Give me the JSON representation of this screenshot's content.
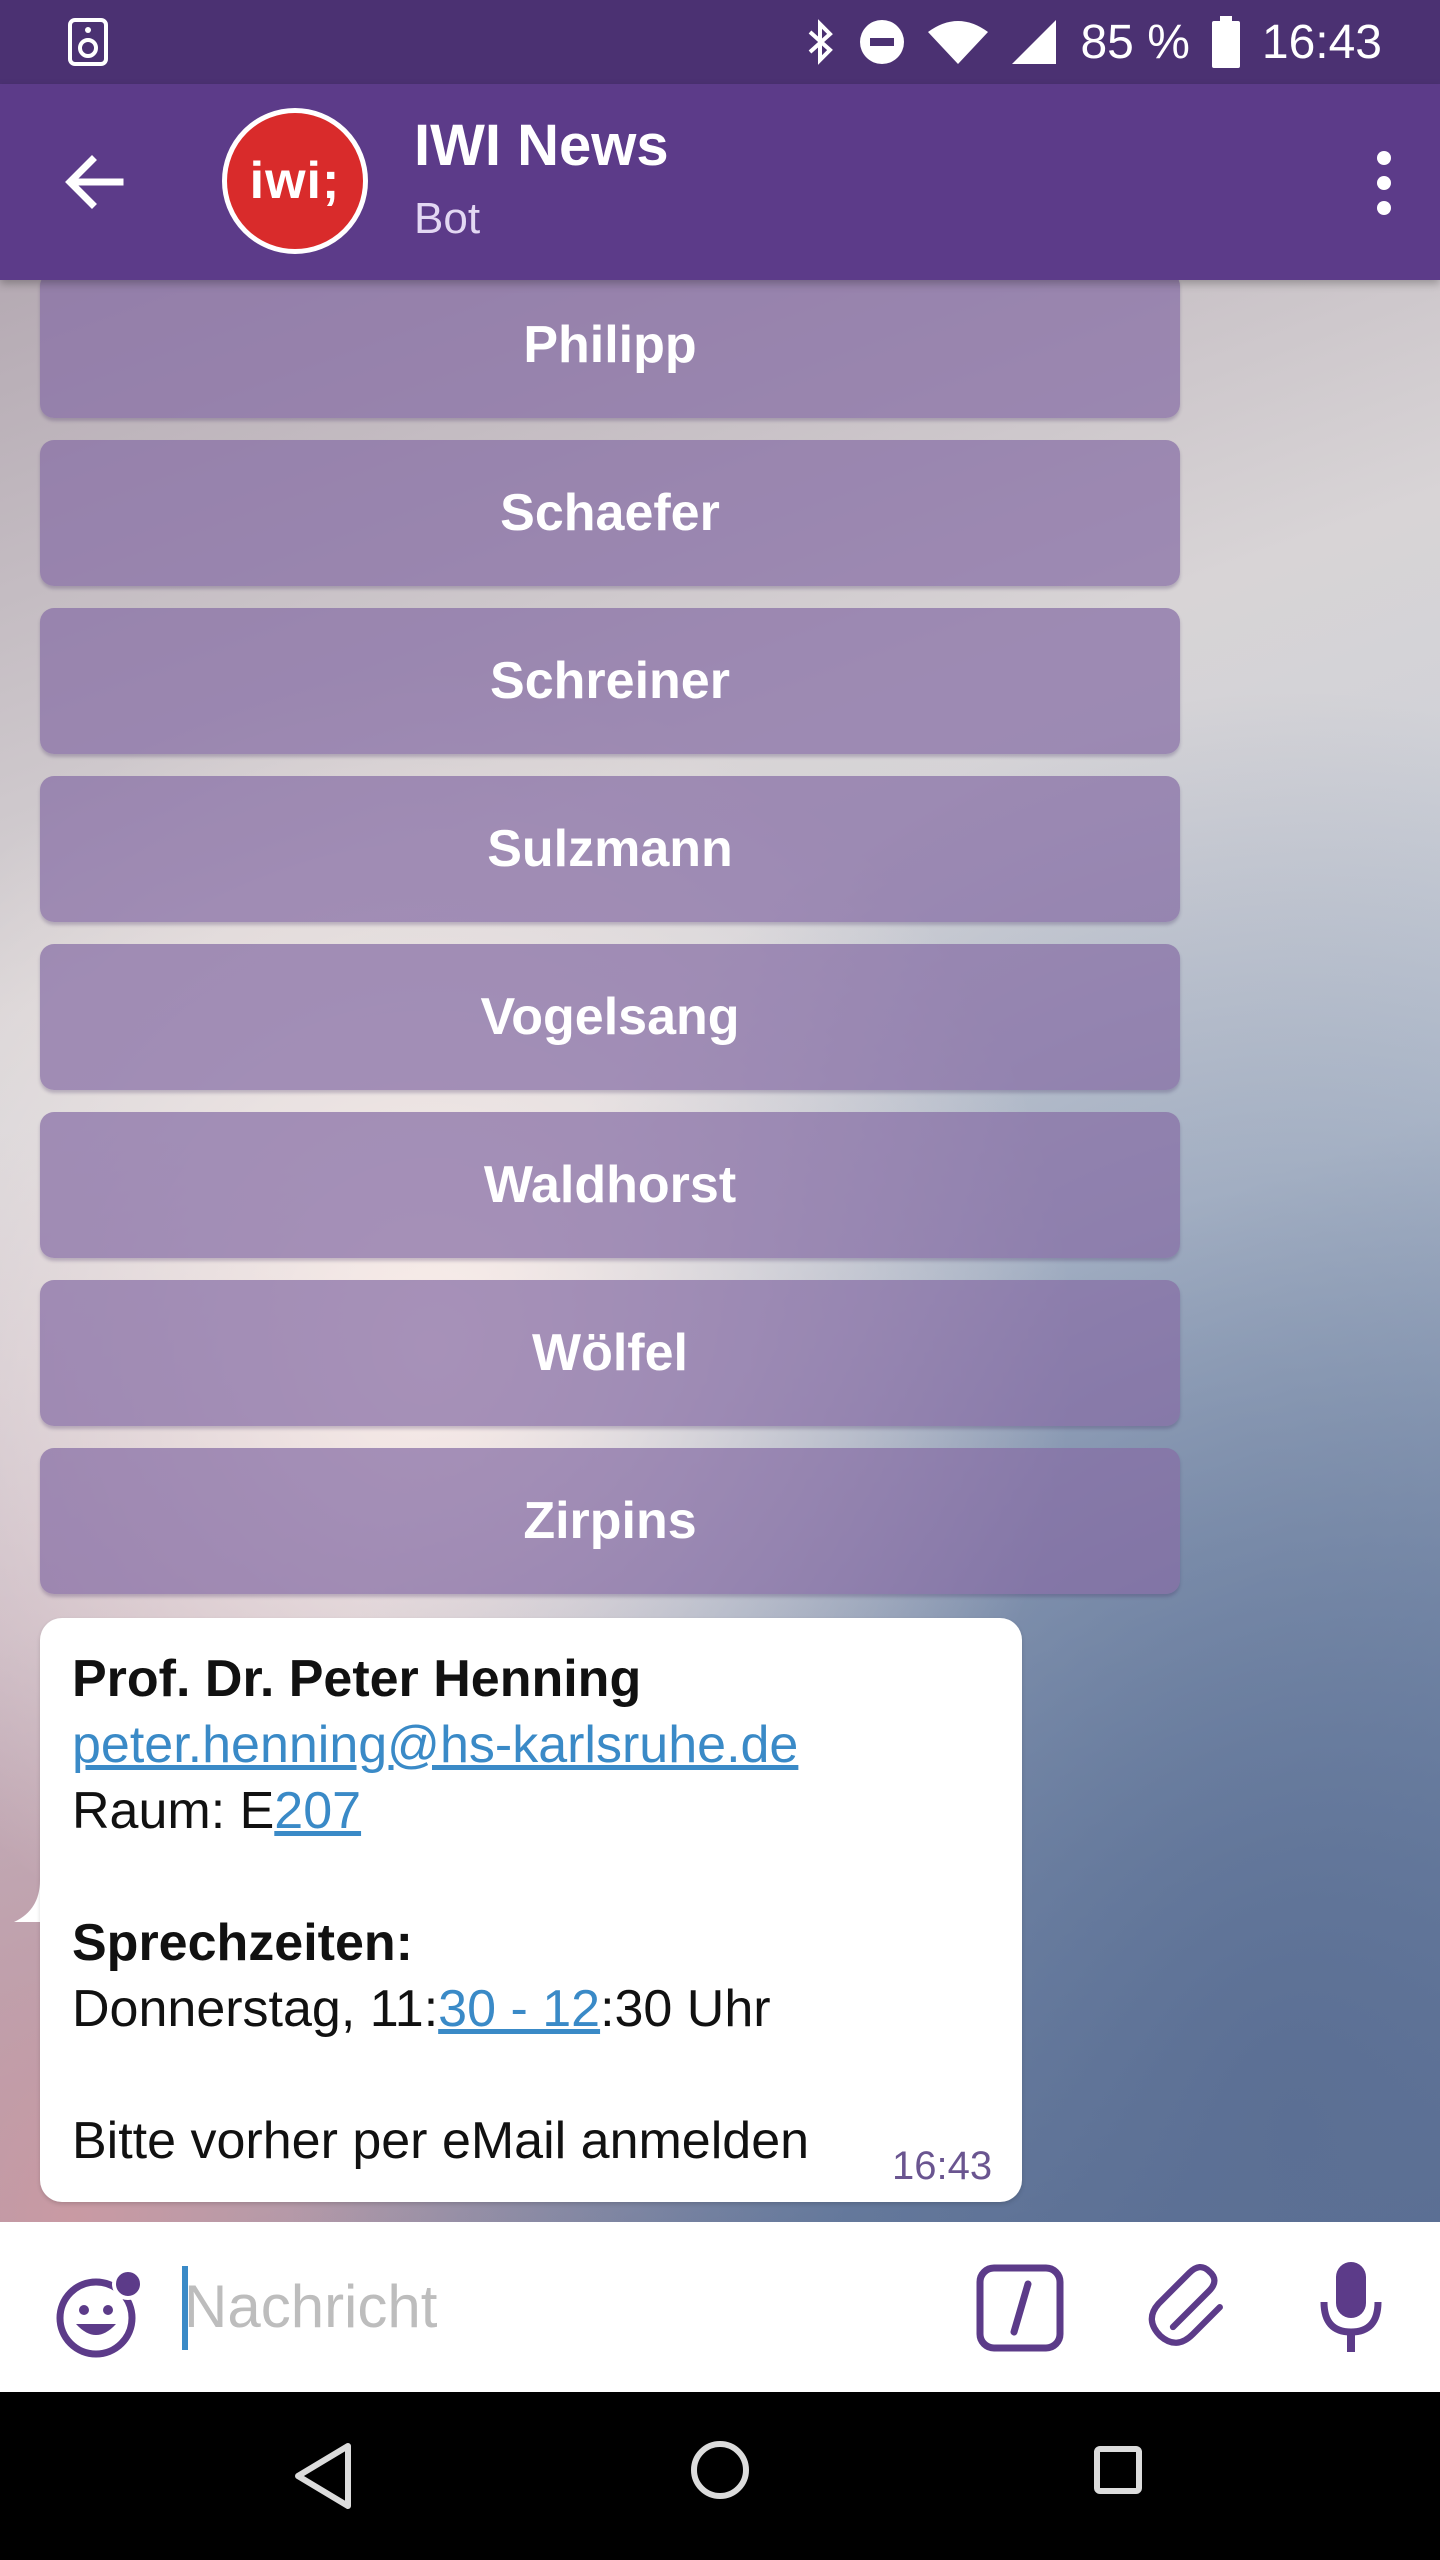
{
  "status_bar": {
    "battery_text": "85 %",
    "time": "16:43",
    "icons": [
      "sound-icon",
      "bluetooth-icon",
      "do-not-disturb-icon",
      "wifi-icon",
      "signal-icon",
      "battery-icon"
    ]
  },
  "header": {
    "avatar_text": "iwi;",
    "title": "IWI News",
    "subtitle": "Bot"
  },
  "keyboard_buttons": [
    "Philipp",
    "Schaefer",
    "Schreiner",
    "Sulzmann",
    "Vogelsang",
    "Waldhorst",
    "Wölfel",
    "Zirpins"
  ],
  "message": {
    "name": "Prof. Dr. Peter Henning",
    "email": "peter.henning@hs-karlsruhe.de",
    "room_prefix": "Raum: E",
    "room_link": "207",
    "hours_label": "Sprechzeiten:",
    "hours_prefix": "Donnerstag, 11:",
    "hours_link": "30 - 12",
    "hours_suffix": ":30 Uhr",
    "note": "Bitte vorher per eMail anmelden",
    "time": "16:43"
  },
  "input": {
    "placeholder": "Nachricht"
  },
  "colors": {
    "status_bar": "#4b3172",
    "app_bar": "#5c3b89",
    "accent": "#5c3b89",
    "link": "#3a8ac7",
    "avatar": "#d92b2b"
  }
}
